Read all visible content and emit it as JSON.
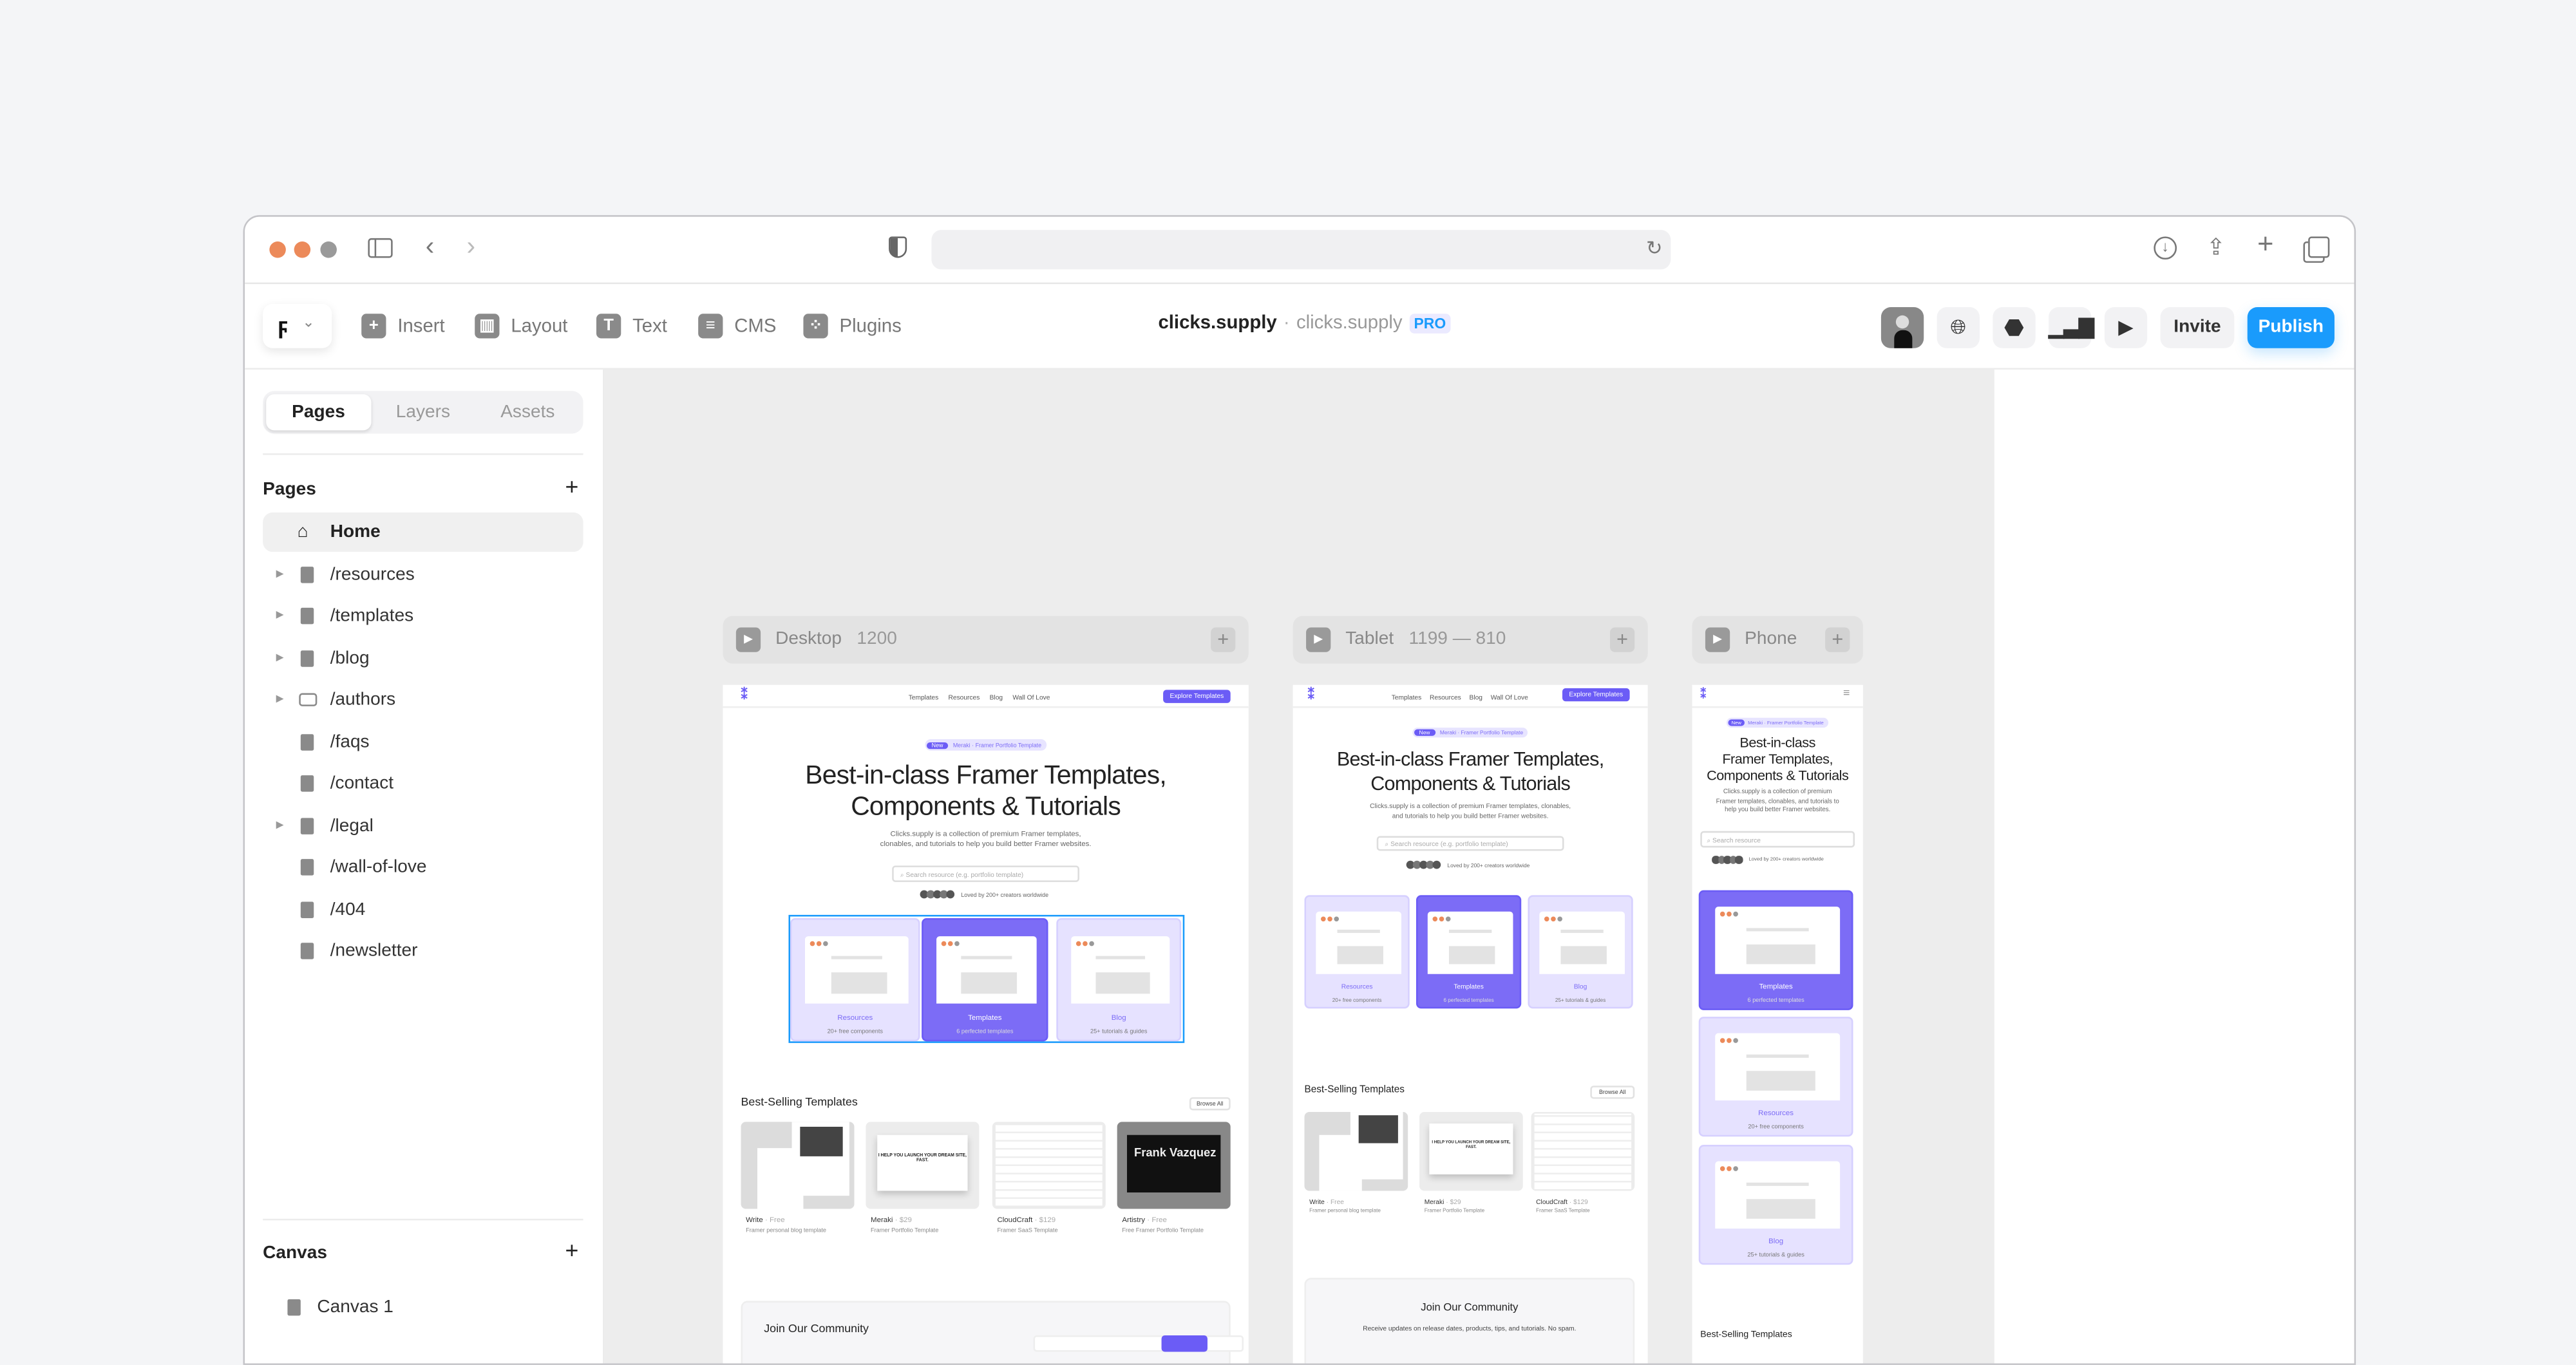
{
  "browser": {
    "traffic_light_colors": [
      "#ec8a5a",
      "#ec8a5a",
      "#9a9a9a"
    ],
    "icons": [
      "sidebar-icon",
      "back-icon",
      "forward-icon",
      "shield-icon",
      "reload-icon",
      "download-icon",
      "share-icon",
      "new-tab-icon",
      "tabs-icon"
    ]
  },
  "toolbar": {
    "insert": "Insert",
    "layout": "Layout",
    "text": "Text",
    "cms": "CMS",
    "plugins": "Plugins",
    "project": "clicks.supply",
    "separator": "·",
    "domain": "clicks.supply",
    "plan": "PRO",
    "invite": "Invite",
    "publish": "Publish",
    "publish_color": "#1a9bfc",
    "plan_color": "#1a9bfc"
  },
  "left_panel": {
    "tabs": [
      "Pages",
      "Layers",
      "Assets"
    ],
    "active_tab": "Pages",
    "pages_heading": "Pages",
    "pages": [
      {
        "label": "Home",
        "icon": "home-icon",
        "expandable": false,
        "selected": true
      },
      {
        "label": "/resources",
        "icon": "page-icon",
        "expandable": true
      },
      {
        "label": "/templates",
        "icon": "page-icon",
        "expandable": true
      },
      {
        "label": "/blog",
        "icon": "page-icon",
        "expandable": true
      },
      {
        "label": "/authors",
        "icon": "folder-icon",
        "expandable": true
      },
      {
        "label": "/faqs",
        "icon": "page-icon",
        "expandable": false
      },
      {
        "label": "/contact",
        "icon": "page-icon",
        "expandable": false
      },
      {
        "label": "/legal",
        "icon": "page-icon",
        "expandable": true
      },
      {
        "label": "/wall-of-love",
        "icon": "page-icon",
        "expandable": false
      },
      {
        "label": "/404",
        "icon": "page-icon",
        "expandable": false
      },
      {
        "label": "/newsletter",
        "icon": "page-icon",
        "expandable": false
      }
    ],
    "canvas_heading": "Canvas",
    "canvases": [
      "Canvas 1"
    ]
  },
  "breakpoints": {
    "desktop": {
      "name": "Desktop",
      "size": "1200"
    },
    "tablet": {
      "name": "Tablet",
      "size": "1199 — 810"
    },
    "phone": {
      "name": "Phone"
    }
  },
  "site": {
    "nav": [
      "Templates",
      "Resources",
      "Blog",
      "Wall Of Love"
    ],
    "cta": "Explore Templates",
    "badge_tag": "New",
    "badge_text": "Meraki · Framer Portfolio Template",
    "heading_1": "Best-in-class Framer Templates,",
    "heading_2": "Components & Tutorials",
    "phone_heading": [
      "Best-in-class",
      "Framer Templates,",
      "Components & Tutorials"
    ],
    "description": "Clicks.supply is a collection of premium Framer templates, clonables, and tutorials to help you build better Framer websites.",
    "search_placeholder": "Search resource (e.g. portfolio template)",
    "phone_search_placeholder": "Search resource",
    "loved": "Loved by 200+ creators worldwide",
    "cards": [
      {
        "title": "Resources",
        "subtitle": "20+ free components"
      },
      {
        "title": "Templates",
        "subtitle": "6 perfected templates"
      },
      {
        "title": "Blog",
        "subtitle": "25+ tutorials & guides"
      }
    ],
    "best_selling": "Best-Selling Templates",
    "browse_all": "Browse All",
    "templates": [
      {
        "name": "Write",
        "price": "Free",
        "desc": "Framer personal blog template"
      },
      {
        "name": "Meraki",
        "price": "$29",
        "desc": "Framer Portfolio Template",
        "image_text": "I HELP YOU LAUNCH YOUR DREAM SITE, FAST."
      },
      {
        "name": "CloudCraft",
        "price": "$129",
        "desc": "Framer SaaS Template"
      },
      {
        "name": "Artistry",
        "price": "Free",
        "desc": "Free Framer Portfolio Template",
        "image_text": "Frank Vazquez"
      }
    ],
    "community_title": "Join Our Community",
    "community_text": "Receive updates on release dates, products, tips, and tutorials. No spam.",
    "accent": "#6b5cf6"
  }
}
